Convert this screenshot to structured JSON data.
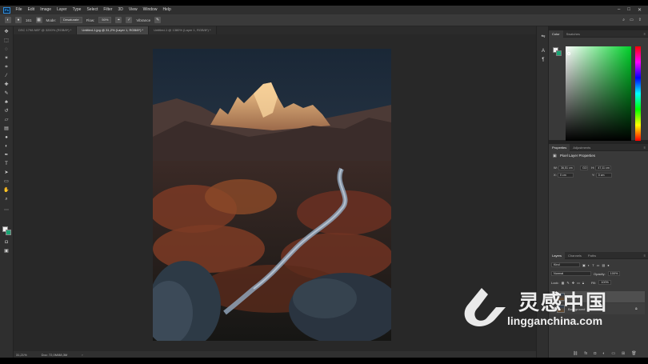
{
  "menubar": {
    "logo": "Ps",
    "items": [
      "File",
      "Edit",
      "Image",
      "Layer",
      "Type",
      "Select",
      "Filter",
      "3D",
      "View",
      "Window",
      "Help"
    ]
  },
  "options": {
    "brush_size": "161",
    "mode_label": "Mode:",
    "mode_value": "Desaturate",
    "flow_label": "Flow:",
    "flow_value": "50%",
    "vibrance_label": "Vibrance"
  },
  "tabs": [
    {
      "label": "DSC 1798.NEF @ 3200% (RGB/8*) *",
      "active": false
    },
    {
      "label": "Untitled-1.jpg @ 31,2% (Layer 1, RGB/8*) *",
      "active": true
    },
    {
      "label": "Untitled-1 @ 1380% (Layer 1, RGB/8*) *",
      "active": false
    }
  ],
  "status": {
    "zoom": "31,21%",
    "doc": "Doc: 72,0M/88,3M"
  },
  "color_panel": {
    "tabs": [
      "Color",
      "Swatches"
    ],
    "foreground": "#f0f0f0",
    "background": "#1aa574"
  },
  "properties_panel": {
    "tabs": [
      "Properties",
      "Adjustments"
    ],
    "title": "Pixel Layer Properties",
    "w_label": "W:",
    "w_value": "36,51 cm",
    "go_label": "GO",
    "h_label": "H:",
    "h_value": "47,11 cm",
    "x_label": "X:",
    "x_value": "0 cm",
    "y_label": "Y:",
    "y_value": "0 cm"
  },
  "layers_panel": {
    "tabs": [
      "Layers",
      "Channels",
      "Paths"
    ],
    "kind": "Kind",
    "blend_mode": "Normal",
    "opacity_label": "Opacity:",
    "opacity_value": "100%",
    "lock_label": "Lock:",
    "fill_label": "Fill:",
    "fill_value": "100%",
    "layer_name": "Layer 1",
    "background_name": "Background"
  },
  "watermark": {
    "cn": "灵感中国",
    "en": "lingganchina.com"
  }
}
